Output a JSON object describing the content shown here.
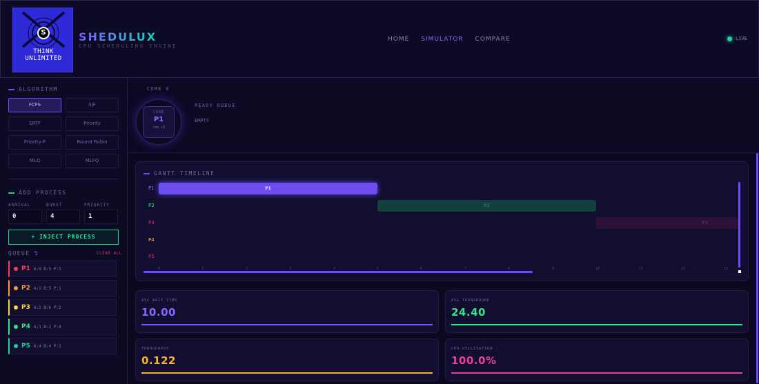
{
  "header": {
    "logo": {
      "badge": "S",
      "line1": "THINK",
      "line2": "UNLIMITED"
    },
    "brand": "SHEDULUX",
    "subtitle": "CPU SCHEDULING ENGINE",
    "nav": [
      {
        "label": "HOME"
      },
      {
        "label": "SIMULATOR"
      },
      {
        "label": "COMPARE"
      }
    ],
    "status": "LIVE"
  },
  "sidebar": {
    "algorithm_label": "ALGORITHM",
    "algorithms": [
      "FCFS",
      "SJF",
      "SRTF",
      "Priority",
      "Priority-P",
      "Round Robin",
      "MLQ",
      "MLFQ"
    ],
    "selected_algorithm": "FCFS",
    "add_process_label": "ADD PROCESS",
    "arrival_label": "ARRIVAL",
    "burst_label": "BURST",
    "priority_label": "PRIORITY",
    "arrival_value": "0",
    "burst_value": "4",
    "priority_value": "1",
    "inject_label": "+ INJECT PROCESS",
    "queue_label": "QUEUE",
    "queue_count": "5",
    "clear_label": "CLEAR ALL",
    "queue": [
      {
        "name": "P1",
        "meta": "A:0 B:5 P:3",
        "color": "#ff3b5c"
      },
      {
        "name": "P2",
        "meta": "A:1 B:5 P:1",
        "color": "#ff9a3c"
      },
      {
        "name": "P3",
        "meta": "A:2 B:6 P:2",
        "color": "#ffd23c"
      },
      {
        "name": "P4",
        "meta": "A:3 B:2 P:4",
        "color": "#3ce27a"
      },
      {
        "name": "P5",
        "meta": "A:4 B:4 P:2",
        "color": "#22d3a4"
      }
    ]
  },
  "core": {
    "label": "CORE 0",
    "inner_label": "CORE",
    "process": "P1",
    "remaining": "rem 10",
    "ready_queue_label": "READY QUEUE",
    "ready_queue_value": "EMPTY"
  },
  "gantt": {
    "title": "GANTT TIMELINE",
    "rows": [
      {
        "name": "P1",
        "color": "#7a52ff",
        "start": 0,
        "end": 5.0,
        "label": "P1"
      },
      {
        "name": "P2",
        "color": "#21d38a",
        "start": 5.0,
        "end": 10.0,
        "label": "P2"
      },
      {
        "name": "P3",
        "color": "#e0267f",
        "start": 10.0,
        "end": 16.0,
        "label": "P3"
      },
      {
        "name": "P4",
        "color": "#ffc83c",
        "start": null,
        "end": null,
        "label": ""
      },
      {
        "name": "P5",
        "color": "#e0267f",
        "start": null,
        "end": null,
        "label": ""
      }
    ],
    "ticks": [
      "0",
      "1",
      "2",
      "3",
      "4",
      "5",
      "6",
      "7",
      "8",
      "9",
      "10",
      "11",
      "12",
      "13"
    ]
  },
  "stats": [
    {
      "label": "AVG WAIT TIME",
      "value": "10.00",
      "color": "#7a52ff"
    },
    {
      "label": "AVG TURNAROUND",
      "value": "24.40",
      "color": "#2ee88a"
    },
    {
      "label": "THROUGHPUT",
      "value": "0.122",
      "color": "#f5b62a"
    },
    {
      "label": "CPU UTILISATION",
      "value": "100.0%",
      "color": "#ee3e9a"
    }
  ]
}
